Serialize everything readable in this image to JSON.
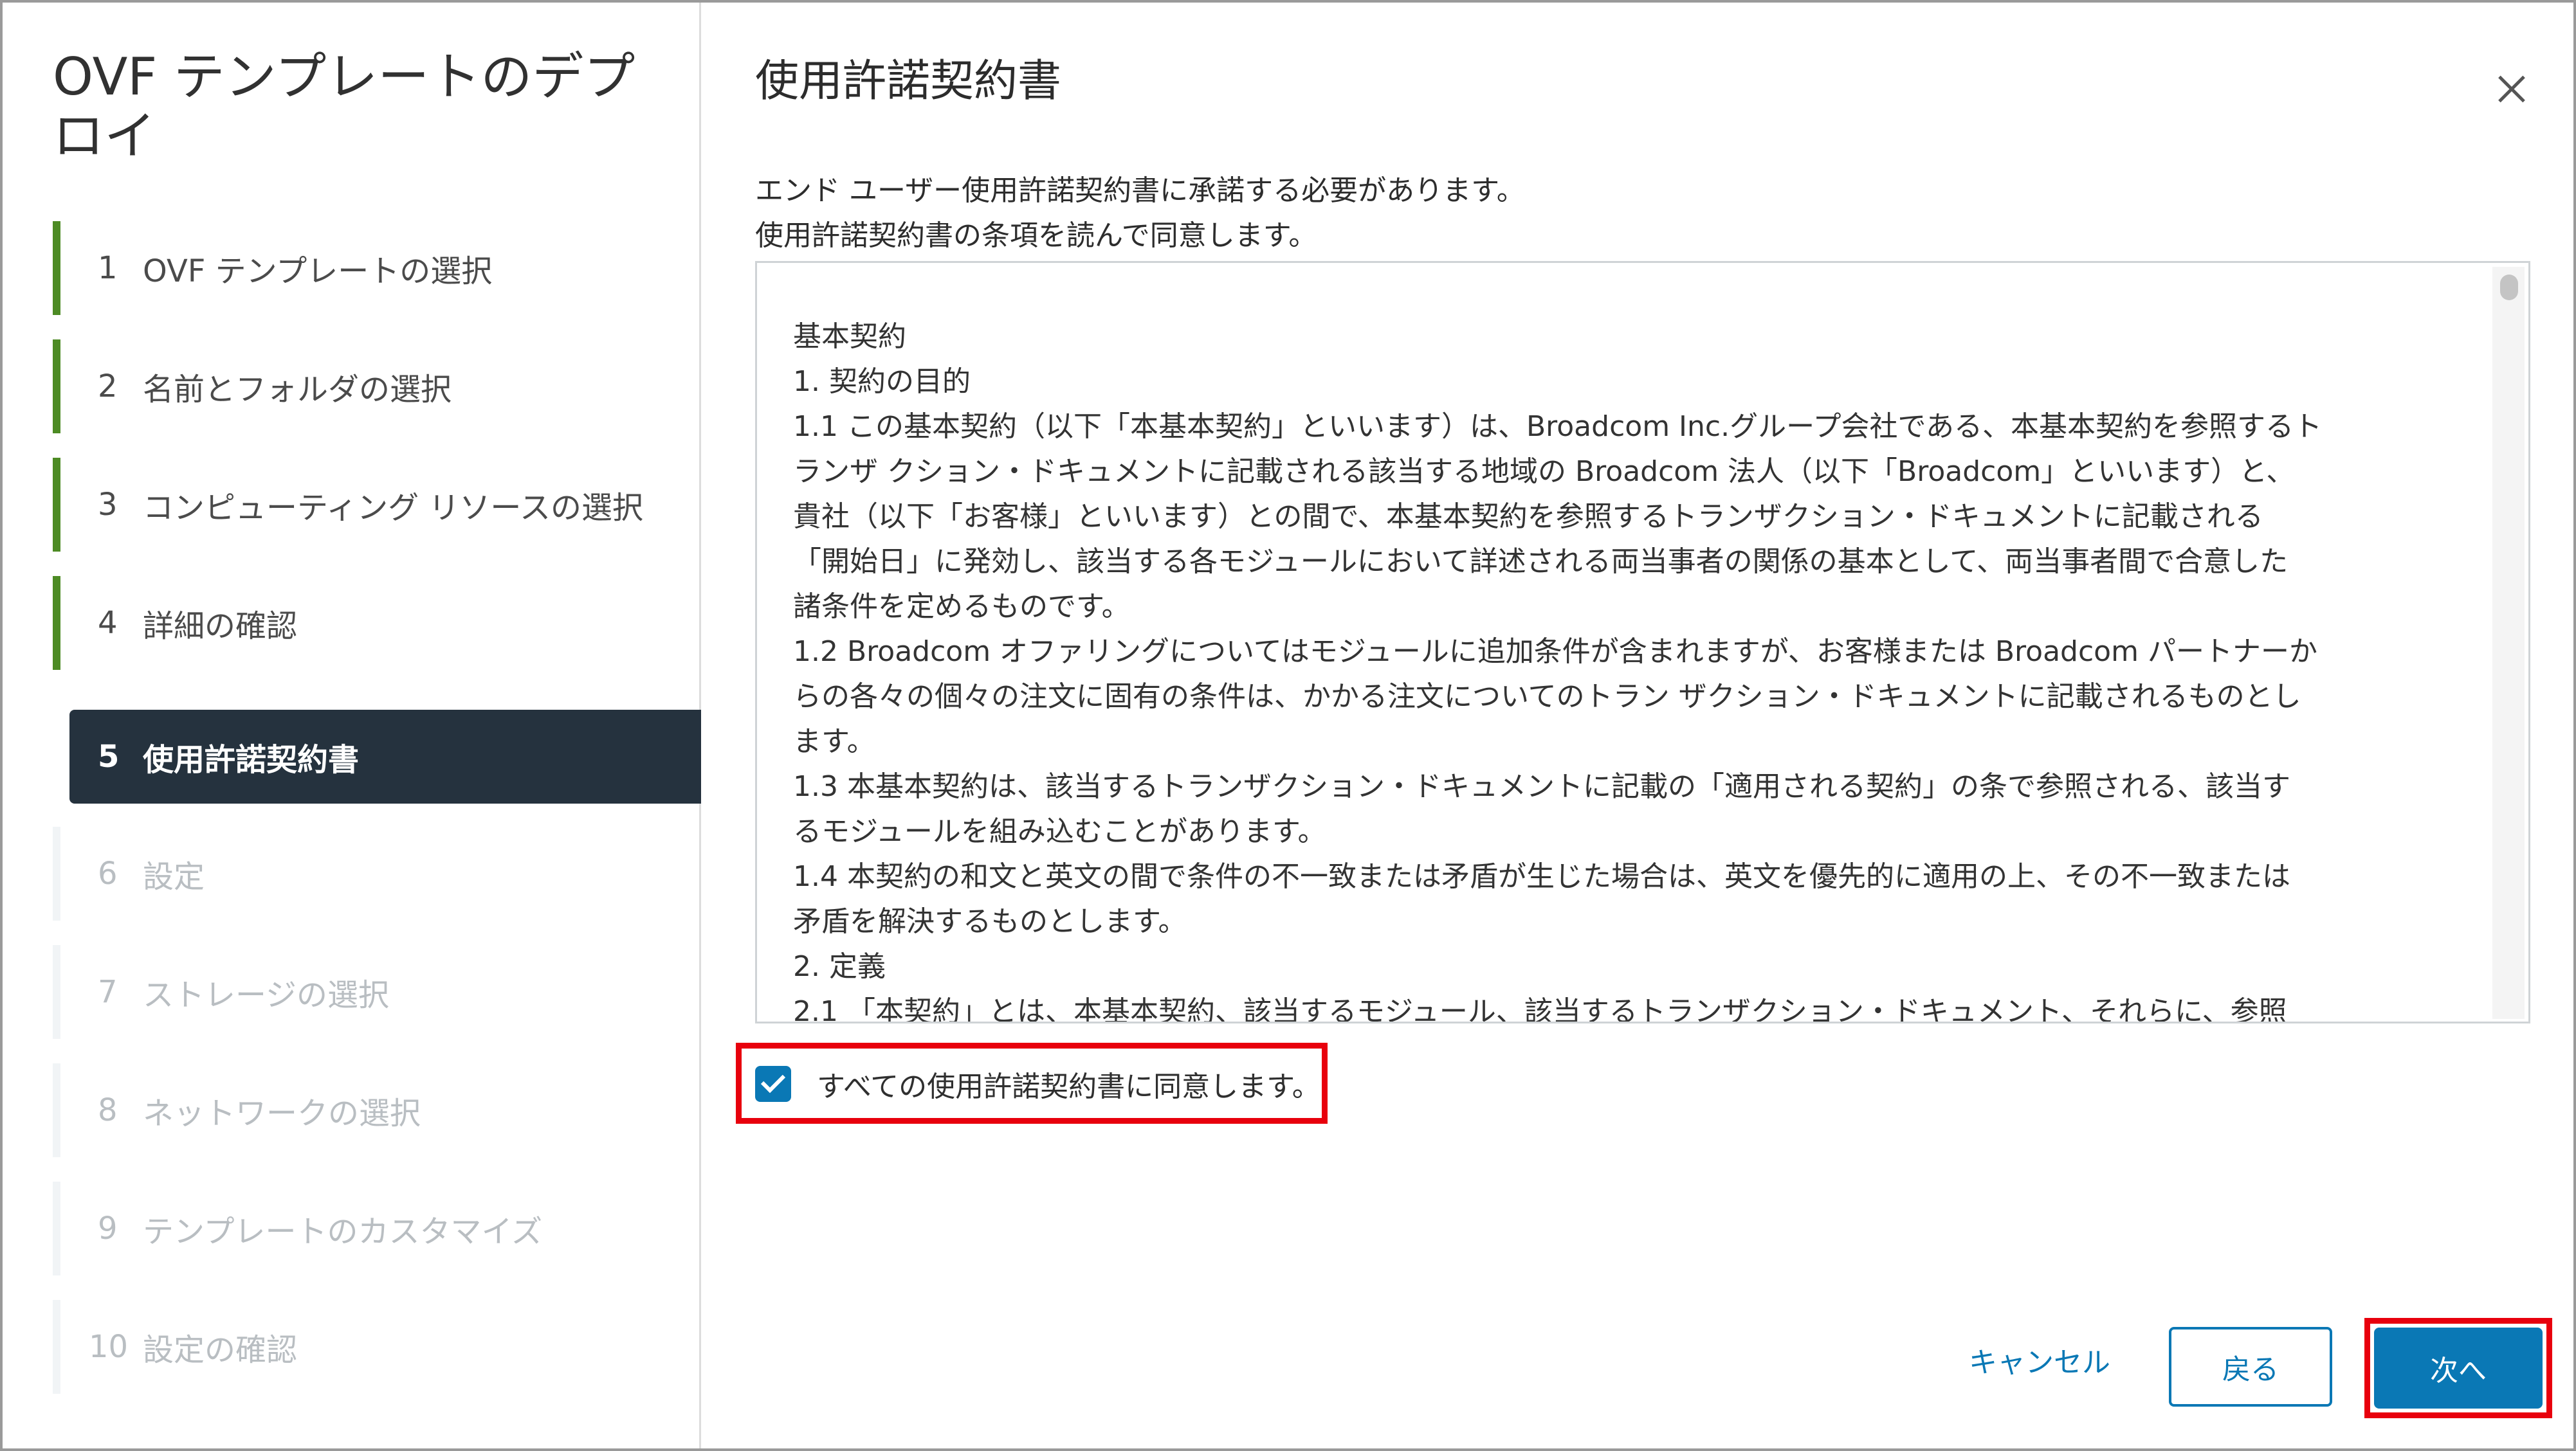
{
  "wizard": {
    "title": "OVF テンプレートのデプロイ"
  },
  "steps": [
    {
      "num": "1",
      "label": "OVF テンプレートの選択",
      "state": "done"
    },
    {
      "num": "2",
      "label": "名前とフォルダの選択",
      "state": "done"
    },
    {
      "num": "3",
      "label": "コンピューティング リソースの選択",
      "state": "done"
    },
    {
      "num": "4",
      "label": "詳細の確認",
      "state": "done"
    },
    {
      "num": "5",
      "label": "使用許諾契約書",
      "state": "active"
    },
    {
      "num": "6",
      "label": "設定",
      "state": "todo"
    },
    {
      "num": "7",
      "label": "ストレージの選択",
      "state": "todo"
    },
    {
      "num": "8",
      "label": "ネットワークの選択",
      "state": "todo"
    },
    {
      "num": "9",
      "label": "テンプレートのカスタマイズ",
      "state": "todo"
    },
    {
      "num": "10",
      "label": "設定の確認",
      "state": "todo"
    }
  ],
  "page": {
    "title": "使用許諾契約書",
    "intro_line1": "エンド ユーザー使用許諾契約書に承諾する必要があります。",
    "intro_line2": "使用許諾契約書の条項を読んで同意します。"
  },
  "license": {
    "lines": [
      "基本契約",
      "1. 契約の目的",
      "1.1 この基本契約（以下「本基本契約」といいます）は、Broadcom Inc.グループ会社である、本基本契約を参照するト",
      "ランザ クション・ドキュメントに記載される該当する地域の Broadcom 法人（以下「Broadcom」といいます）と、",
      "貴社（以下「お客様」といいます）との間で、本基本契約を参照するトランザクション・ドキュメントに記載される",
      "「開始日」に発効し、該当する各モジュールにおいて詳述される両当事者の関係の基本として、両当事者間で合意した",
      "諸条件を定めるものです。",
      "1.2 Broadcom オファリングについてはモジュールに追加条件が含まれますが、お客様または Broadcom パートナーか",
      "らの各々の個々の注文に固有の条件は、かかる注文についてのトラン ザクション・ドキュメントに記載されるものとし",
      "ます。",
      "1.3 本基本契約は、該当するトランザクション・ドキュメントに記載の「適用される契約」の条で参照される、該当す",
      "るモジュールを組み込むことがあります。",
      "1.4 本契約の和文と英文の間で条件の不一致または矛盾が生じた場合は、英文を優先的に適用の上、その不一致または",
      "矛盾を解決するものとします。",
      "2. 定義",
      "2.1 「本契約」とは、本基本契約、該当するモジュール、該当するトランザクション・ドキュメント、それらに、参照"
    ]
  },
  "agreement": {
    "checked": true,
    "label": "すべての使用許諾契約書に同意します。"
  },
  "footer": {
    "cancel_label": "キャンセル",
    "back_label": "戻る",
    "next_label": "次へ"
  },
  "colors": {
    "accent": "#0a78b5",
    "active_step_bg": "#25323e",
    "done_bar": "#4d8b24",
    "highlight": "#e8000d"
  }
}
